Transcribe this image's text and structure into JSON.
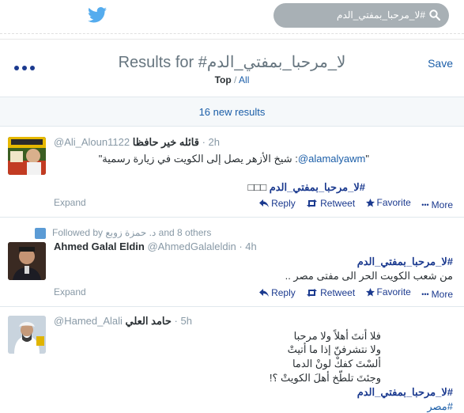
{
  "topbar": {
    "search_value": "#لا_مرحبا_بمفتي_الدم",
    "colors": {
      "brand": "#55acee",
      "search_bg": "#a8b0b5"
    }
  },
  "header": {
    "title_prefix": "Results for ",
    "query": "#لا_مرحبا_بمفتي_الدم",
    "filter_top": "Top",
    "filter_sep": " / ",
    "filter_all": "All",
    "save_label": "Save",
    "more_icon": "more-dots-icon"
  },
  "new_results": "16 new results",
  "actions": {
    "expand": "Expand",
    "reply": "Reply",
    "retweet": "Retweet",
    "favorite": "Favorite",
    "more": "More"
  },
  "tweets": [
    {
      "name": "قائله خير حافظا",
      "handle": "@Ali_Aloun1122",
      "time": "2h",
      "mention": "@alamalyawm",
      "text": ": شيخ الأزهر يصل إلى الكويت في زيارة رسمية\"",
      "quote_open": "\"",
      "hashtag": "#لا_مرحبا_بمفتي_الدم",
      "tail": "□□□"
    },
    {
      "followed_by": "Followed by",
      "followed_name": "د. حمزة زوبع",
      "followed_rest": "and 8 others",
      "name": "Ahmed Galal Eldin",
      "handle": "@AhmedGalaleldin",
      "time": "4h",
      "hashtag": "#لا_مرحبا_بمفتي_الدم",
      "line2": "من شعب الكويت الحر الى مفتى مصر .."
    },
    {
      "name": "حامد العلي",
      "handle": "@Hamed_Alali",
      "time": "5h",
      "lines": [
        "فلا أنتَ أهلاً ولا مرحبا",
        "ولا نتشرفنّ إذا ما أتيتْ",
        "ألسْتَ كفكْ لونْ الدما",
        "وجئتَ تلطّخ أهلَ الكويتْ ؟!"
      ],
      "hashtag": "#لا_مرحبا_بمفتي_الدم",
      "hashtag2": "#مصر"
    }
  ]
}
